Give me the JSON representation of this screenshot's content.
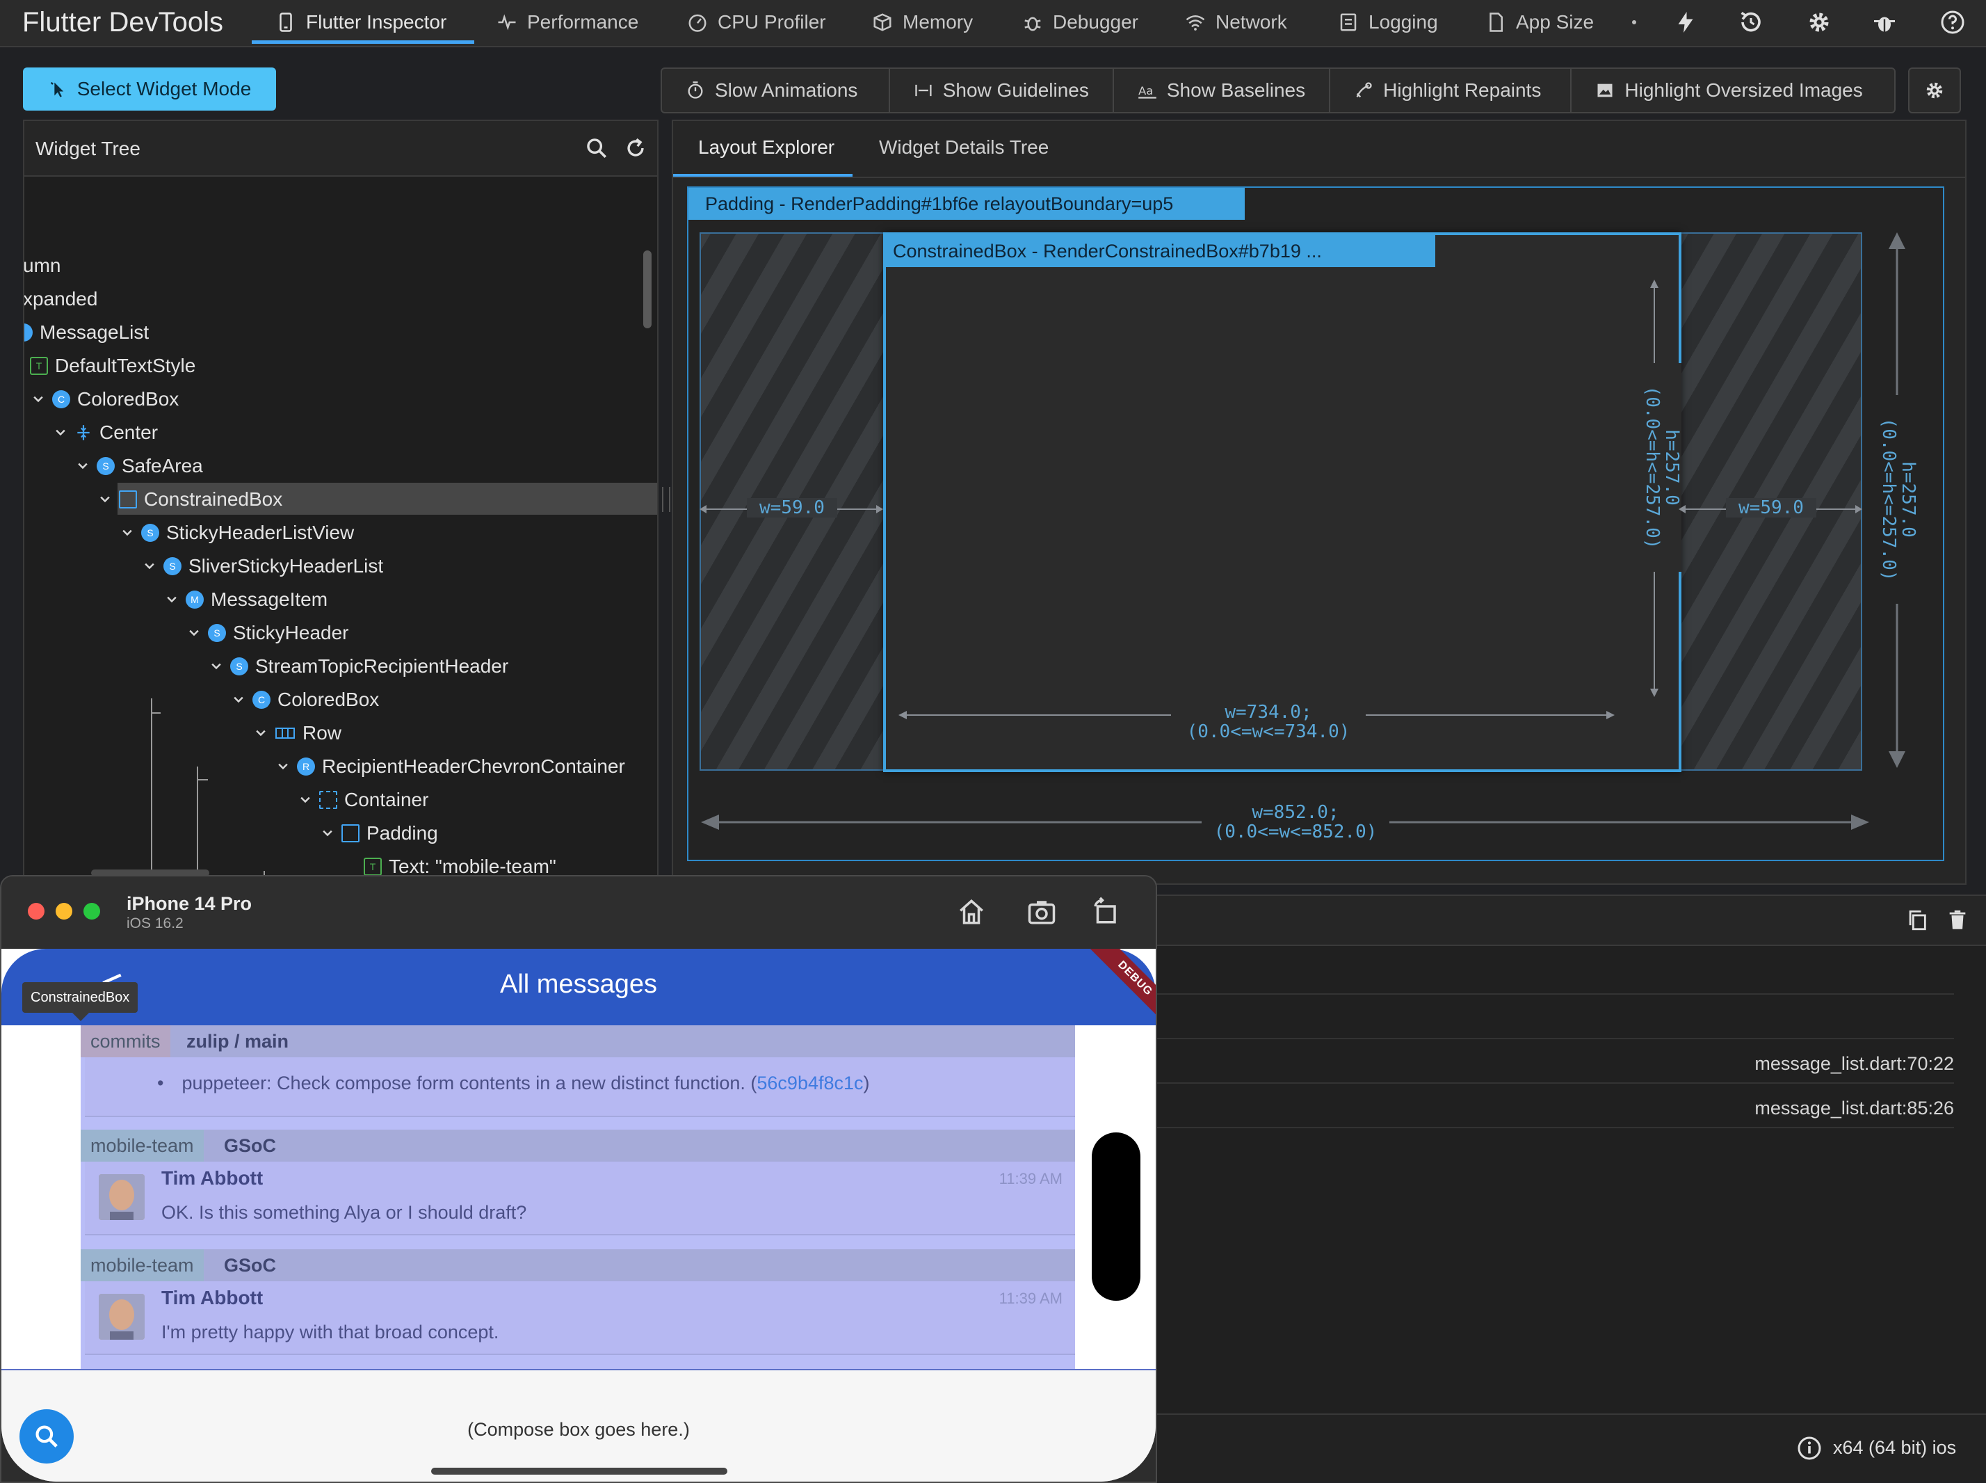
{
  "app": {
    "title": "Flutter DevTools"
  },
  "tabs": [
    {
      "label": "Flutter Inspector",
      "icon": "phone-icon",
      "active": true
    },
    {
      "label": "Performance",
      "icon": "pulse-icon"
    },
    {
      "label": "CPU Profiler",
      "icon": "gauge-icon"
    },
    {
      "label": "Memory",
      "icon": "cube-icon"
    },
    {
      "label": "Debugger",
      "icon": "bug-icon"
    },
    {
      "label": "Network",
      "icon": "wifi-icon"
    },
    {
      "label": "Logging",
      "icon": "logging-icon"
    },
    {
      "label": "App Size",
      "icon": "file-icon"
    }
  ],
  "toolbar": {
    "select_widget_mode": "Select Widget Mode",
    "overlays": [
      "Slow Animations",
      "Show Guidelines",
      "Show Baselines",
      "Highlight Repaints",
      "Highlight Oversized Images"
    ]
  },
  "widget_tree": {
    "title": "Widget Tree",
    "nodes": [
      {
        "label": "umn"
      },
      {
        "label": "xpanded"
      },
      {
        "label": "MessageList",
        "badge": ""
      },
      {
        "label": "DefaultTextStyle",
        "badge": "T"
      },
      {
        "label": "ColoredBox",
        "badge": "C"
      },
      {
        "label": "Center",
        "badge": ""
      },
      {
        "label": "SafeArea",
        "badge": "S"
      },
      {
        "label": "ConstrainedBox",
        "badge": "",
        "selected": true
      },
      {
        "label": "StickyHeaderListView",
        "badge": "S"
      },
      {
        "label": "SliverStickyHeaderList",
        "badge": "S"
      },
      {
        "label": "MessageItem",
        "badge": "M"
      },
      {
        "label": "StickyHeader",
        "badge": "S"
      },
      {
        "label": "StreamTopicRecipientHeader",
        "badge": "S"
      },
      {
        "label": "ColoredBox",
        "badge": "C"
      },
      {
        "label": "Row",
        "badge": ""
      },
      {
        "label": "RecipientHeaderChevronContainer",
        "badge": "R"
      },
      {
        "label": "Container",
        "badge": ""
      },
      {
        "label": "Padding",
        "badge": ""
      },
      {
        "label": "Text: \"mobile-team\"",
        "badge": "T"
      }
    ]
  },
  "layout_explorer": {
    "tabs": [
      "Layout Explorer",
      "Widget Details Tree"
    ],
    "outer_header": "Padding - RenderPadding#1bf6e relayoutBoundary=up5",
    "inner_header": "ConstrainedBox - RenderConstrainedBox#b7b19 ...",
    "left_padding": "w=59.0",
    "right_padding": "w=59.0",
    "inner_height": "h=257.0",
    "inner_height_range": "(0.0<=h<=257.0)",
    "inner_width": "w=734.0;",
    "inner_width_range": "(0.0<=w<=734.0)",
    "outer_height": "h=257.0",
    "outer_height_range": "(0.0<=h<=257.0)",
    "outer_width": "w=852.0;",
    "outer_width_range": "(0.0<=w<=852.0)"
  },
  "console": {
    "sources": [
      "message_list.dart:70:22",
      "message_list.dart:85:26"
    ]
  },
  "status": {
    "platform": "x64 (64 bit) ios"
  },
  "simulator": {
    "device": "iPhone 14 Pro",
    "os": "iOS 16.2",
    "app_title": "All messages",
    "debug_banner": "DEBUG",
    "tooltip": "ConstrainedBox",
    "headers": [
      {
        "stream": "commits",
        "topic": "zulip / main"
      },
      {
        "stream": "mobile-team",
        "topic": "GSoC"
      },
      {
        "stream": "mobile-team",
        "topic": "GSoC"
      }
    ],
    "commit_line": "puppeteer: Check compose form contents in a new distinct function. (",
    "commit_hash": "56c9b4f8c1c",
    "commit_close": ")",
    "messages": [
      {
        "sender": "Tim Abbott",
        "time": "11:39 AM",
        "text": "OK. Is this something Alya or I should draft?"
      },
      {
        "sender": "Tim Abbott",
        "time": "11:39 AM",
        "text": "I'm pretty happy with that broad concept."
      }
    ],
    "compose_placeholder": "(Compose box goes here.)"
  },
  "colors": {
    "accent": "#42a5f5",
    "appbar": "#2c58c4",
    "select_button": "#4fc3f7"
  }
}
